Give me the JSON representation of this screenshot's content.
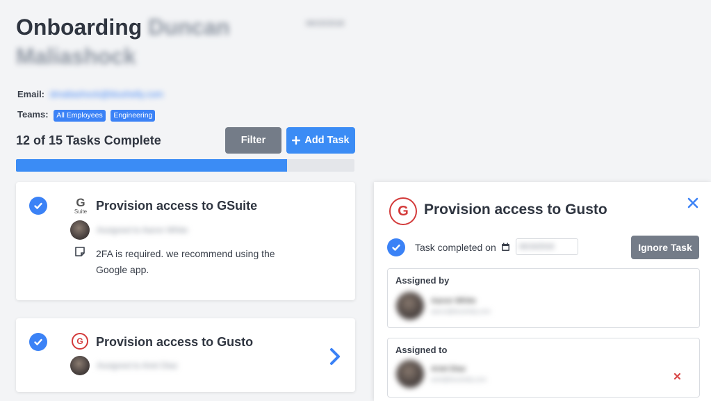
{
  "header": {
    "title_prefix": "Onboarding",
    "title_name": "Duncan Maliashock",
    "date": "06/15/2018"
  },
  "profile": {
    "email_label": "Email:",
    "email": "dmaliashock@blushelly.com",
    "teams_label": "Teams:",
    "teams": [
      "All Employees",
      "Engineering"
    ]
  },
  "progress": {
    "text": "12 of 15 Tasks Complete",
    "completed": 12,
    "total": 15,
    "filter_label": "Filter",
    "add_task_label": "Add Task"
  },
  "tasks": [
    {
      "title": "Provision access to GSuite",
      "logo_text_top": "G",
      "logo_text_bottom": "Suite",
      "assignee": "Assigned to Aaron White",
      "note": "2FA is required. we recommend using the Google app.",
      "completed": true
    },
    {
      "title": "Provision access to Gusto",
      "logo_text": "G",
      "assignee": "Assigned to Ariel Diaz",
      "completed": true
    }
  ],
  "detail": {
    "logo_text": "G",
    "title": "Provision access to Gusto",
    "completed_label": "Task completed on",
    "completed_date": "06/16/2018",
    "ignore_label": "Ignore Task",
    "assigned_by_label": "Assigned by",
    "assigned_by_name": "Aaron White",
    "assigned_by_email": "aaron@blushelly.com",
    "assigned_to_label": "Assigned to",
    "assigned_to_name": "Ariel Diaz",
    "assigned_to_email": "ariel@blushelly.com"
  },
  "colors": {
    "accent": "#3b8cf5",
    "gray_button": "#747c88",
    "gusto_red": "#d33a3a",
    "remove_red": "#d94848"
  },
  "icons": [
    "check-circle-icon",
    "gsuite-logo-icon",
    "gusto-logo-icon",
    "note-icon",
    "chevron-right-icon",
    "close-icon",
    "calendar-icon",
    "plus-icon",
    "remove-icon"
  ]
}
